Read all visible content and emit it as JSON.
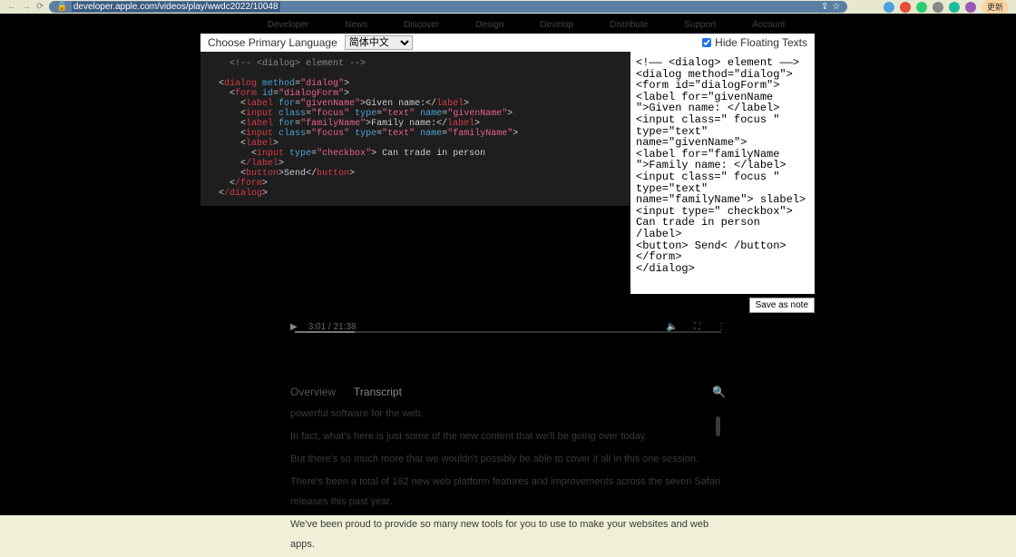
{
  "browser": {
    "url": "developer.apple.com/videos/play/wwdc2022/10048",
    "update_label": "更新"
  },
  "apple_nav": [
    "Developer",
    "News",
    "Discover",
    "Design",
    "Develop",
    "Distribute",
    "Support",
    "Account"
  ],
  "overlay": {
    "choose_lang_label": "Choose Primary Language",
    "lang_selected": "简体中文",
    "hide_label": "Hide Floating Texts",
    "hide_checked": true
  },
  "code": {
    "comment": "<!-- <dialog> element -->",
    "lines": [
      {
        "indent": 0,
        "tag_open": "dialog",
        "attrs": [
          [
            "method",
            "dialog"
          ]
        ],
        "text": "",
        "tag_close": ""
      },
      {
        "indent": 1,
        "tag_open": "form",
        "attrs": [
          [
            "id",
            "dialogForm"
          ]
        ],
        "text": "",
        "tag_close": ""
      },
      {
        "indent": 2,
        "tag_open": "label",
        "attrs": [
          [
            "for",
            "givenName"
          ]
        ],
        "text": "Given name:",
        "tag_close": "label"
      },
      {
        "indent": 2,
        "tag_open": "input",
        "attrs": [
          [
            "class",
            "focus"
          ],
          [
            "type",
            "text"
          ],
          [
            "name",
            "givenName"
          ]
        ],
        "text": "",
        "tag_close": ""
      },
      {
        "indent": 2,
        "tag_open": "label",
        "attrs": [
          [
            "for",
            "familyName"
          ]
        ],
        "text": "Family name:",
        "tag_close": "label"
      },
      {
        "indent": 2,
        "tag_open": "input",
        "attrs": [
          [
            "class",
            "focus"
          ],
          [
            "type",
            "text"
          ],
          [
            "name",
            "familyName"
          ]
        ],
        "text": "",
        "tag_close": ""
      },
      {
        "indent": 2,
        "tag_open": "label",
        "attrs": [],
        "text": "",
        "tag_close": ""
      },
      {
        "indent": 3,
        "tag_open": "input",
        "attrs": [
          [
            "type",
            "checkbox"
          ]
        ],
        "text": " Can trade in person",
        "tag_close": ""
      },
      {
        "indent": 2,
        "tag_open": "/label",
        "attrs": [],
        "text": "",
        "tag_close": ""
      },
      {
        "indent": 2,
        "tag_open": "button",
        "attrs": [],
        "text": "Send",
        "tag_close": "button"
      },
      {
        "indent": 1,
        "tag_open": "/form",
        "attrs": [],
        "text": "",
        "tag_close": ""
      },
      {
        "indent": 0,
        "tag_open": "/dialog",
        "attrs": [],
        "text": "",
        "tag_close": ""
      }
    ]
  },
  "ocr_text": "<!—— <dialog> element ——>\n<dialog method=\"dialog\">\n<form id=\"dialogForm\">\n<label for=\"givenName \">Given name: </label>\n<input class=\" focus \" type=\"text\" name=\"givenName\">\n<label for=\"familyName \">Family name: </label>\n<input class=\" focus \" type=\"text\" name=\"familyName\"> slabel>\n<input type=\" checkbox\"> Can trade in person\n/label>\n<button> Send< /button>\n</form>\n</dialog>",
  "save_note_label": "Save as note",
  "video": {
    "current_time": "3:01",
    "total_time": "21:38"
  },
  "tabs": {
    "overview": "Overview",
    "transcript": "Transcript"
  },
  "transcript_lines": [
    "powerful software for the web.",
    "In fact, what's here is just some of the new content that we'll be going over today.",
    "But there's so much more that we wouldn't possibly be able to cover it all in this one session.",
    "There's been a total of 162 new web platform features and improvements across the seven Safari releases this past year.",
    "We've been proud to provide so many new tools for you to use to make your websites and web apps."
  ]
}
